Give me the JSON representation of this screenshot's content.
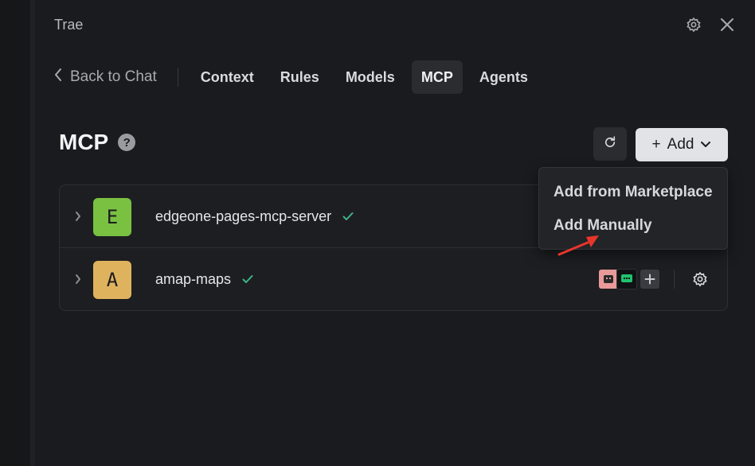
{
  "app": {
    "title": "Trae"
  },
  "header": {
    "icons": [
      "gear-icon",
      "close-icon"
    ]
  },
  "nav": {
    "back_label": "Back to Chat",
    "tabs": [
      {
        "label": "Context",
        "active": false
      },
      {
        "label": "Rules",
        "active": false
      },
      {
        "label": "Models",
        "active": false
      },
      {
        "label": "MCP",
        "active": true
      },
      {
        "label": "Agents",
        "active": false
      }
    ]
  },
  "section": {
    "title": "MCP",
    "help_icon": "?",
    "add_label": "Add",
    "add_plus": "+"
  },
  "servers": [
    {
      "letter": "E",
      "name": "edgeone-pages-mcp-server",
      "status_icon": "check-icon",
      "avatar_color": "#7ac142"
    },
    {
      "letter": "A",
      "name": "amap-maps",
      "status_icon": "check-icon",
      "avatar_color": "#dfb35e"
    }
  ],
  "dropdown": {
    "items": [
      "Add from Marketplace",
      "Add Manually"
    ]
  },
  "colors": {
    "accent_check": "#3fb489",
    "annotation_arrow": "#e8352b",
    "active_tab_bg": "#2b2c30"
  }
}
